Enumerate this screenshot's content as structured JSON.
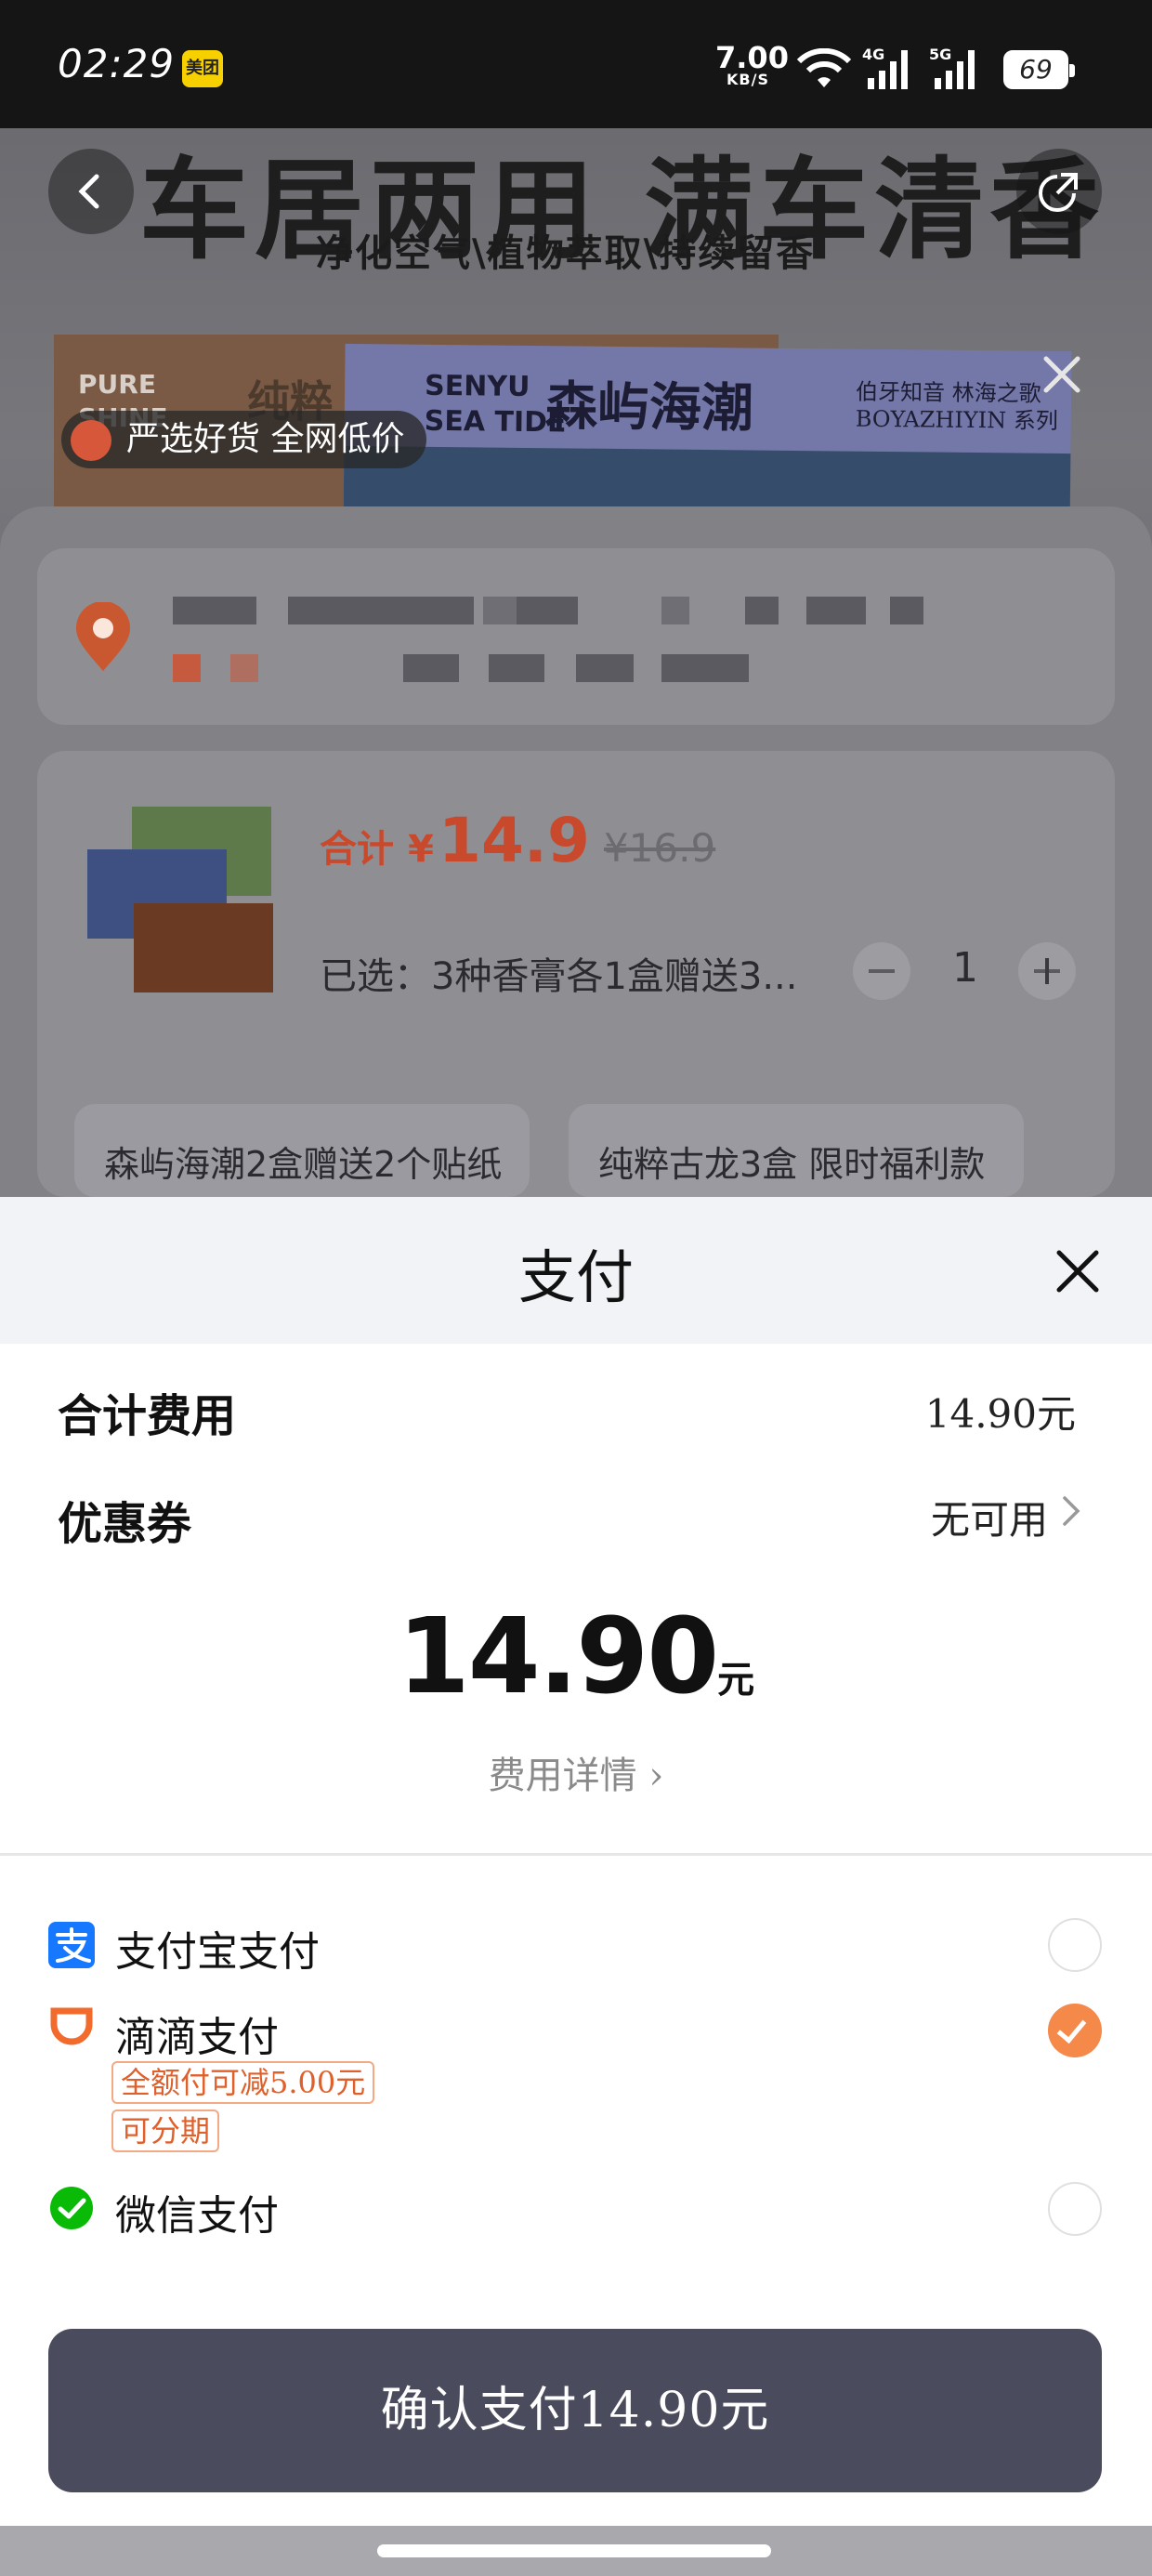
{
  "status_bar": {
    "time": "02:29",
    "app_badge": "美团",
    "net_speed": "7.00",
    "net_unit": "KB/S",
    "sig1_label": "4G",
    "sig2_label": "5G",
    "battery": "69"
  },
  "banner": {
    "headline": "车居两用 满车清香",
    "subline": "净化空气\\植物萃取\\持续留香",
    "box1_en": "PURE\nSHINE",
    "box1_cn": "纯粹",
    "box2_en": "SENYU\nSEA TIDE",
    "box2_cn": "森屿海潮",
    "box2_brand": "伯牙知音  林海之歌\nBOYAZHIYIN 系列",
    "promo": "严选好货 全网低价"
  },
  "order": {
    "total_label": "合计",
    "currency": "¥",
    "price": "14.9",
    "original_price": "¥16.9",
    "selected": "已选：3种香膏各1盒赠送3...",
    "quantity": "1",
    "options": [
      "森屿海潮2盒赠送2个贴纸",
      "纯粹古龙3盒 限时福利款"
    ]
  },
  "payment": {
    "title": "支付",
    "total_fee_label": "合计费用",
    "total_fee_value": "14.90元",
    "coupon_label": "优惠券",
    "coupon_value": "无可用",
    "amount": "14.90",
    "amount_unit": "元",
    "fee_detail": "费用详情 ›",
    "methods": [
      {
        "label": "支付宝支付",
        "icon": "alipay-icon",
        "selected": false
      },
      {
        "label": "滴滴支付",
        "icon": "didi-icon",
        "selected": true,
        "tags": [
          "全额付可减5.00元",
          "可分期"
        ]
      },
      {
        "label": "微信支付",
        "icon": "wechat-icon",
        "selected": false
      }
    ],
    "confirm": "确认支付14.90元"
  },
  "colors": {
    "accent_orange": "#f5894a",
    "price_red": "#c9492c",
    "confirm_button": "#4a4b5c"
  }
}
